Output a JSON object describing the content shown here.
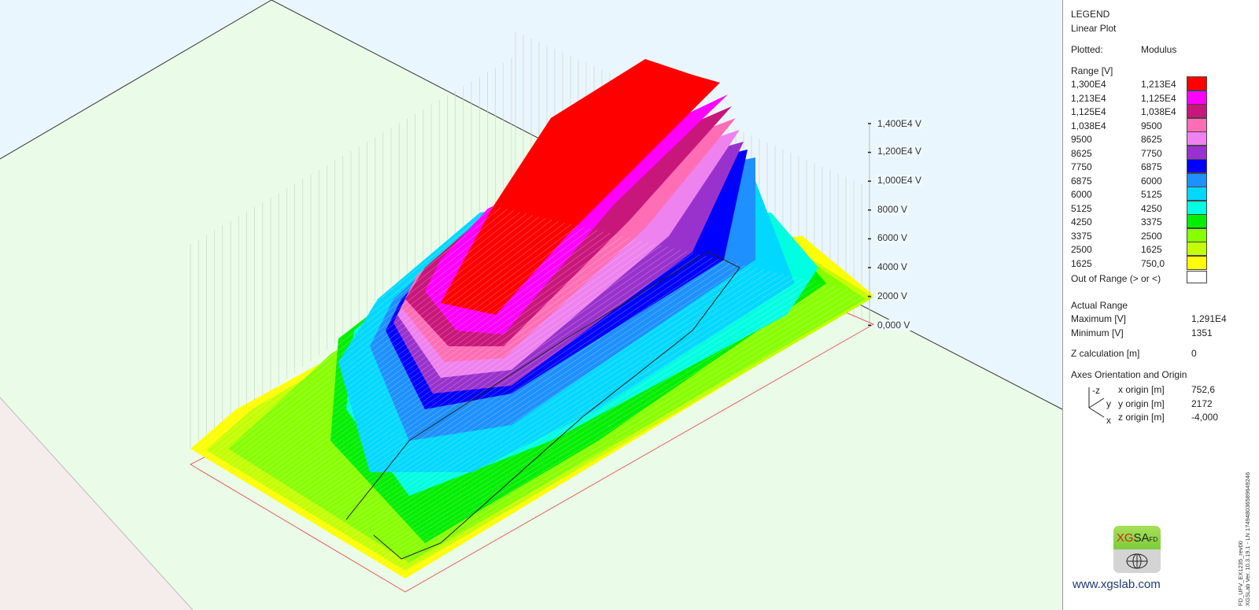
{
  "chart_data": {
    "type": "heatmap",
    "subtype": "3d-surface",
    "z_axis_ticks": [
      "1,400E4 V",
      "1,200E4 V",
      "1,000E4 V",
      "8000 V",
      "6000 V",
      "4000 V",
      "2000 V",
      "0,000 V"
    ],
    "z_range_V": [
      0,
      14000
    ],
    "grid": true
  },
  "legend": {
    "title": "LEGEND",
    "plot_type": "Linear Plot",
    "plotted_label": "Plotted:",
    "plotted_value": "Modulus",
    "range_label": "Range [V]",
    "bins": [
      {
        "from": "1,300E4",
        "to": "1,213E4",
        "color": "#ff0000"
      },
      {
        "from": "1,213E4",
        "to": "1,125E4",
        "color": "#ff00ff"
      },
      {
        "from": "1,125E4",
        "to": "1,038E4",
        "color": "#c8177a"
      },
      {
        "from": "1,038E4",
        "to": "9500",
        "color": "#ff6eb4"
      },
      {
        "from": "9500",
        "to": "8625",
        "color": "#ee82ee"
      },
      {
        "from": "8625",
        "to": "7750",
        "color": "#9932cc"
      },
      {
        "from": "7750",
        "to": "6875",
        "color": "#0000ff"
      },
      {
        "from": "6875",
        "to": "6000",
        "color": "#1e90ff"
      },
      {
        "from": "6000",
        "to": "5125",
        "color": "#00d8ff"
      },
      {
        "from": "5125",
        "to": "4250",
        "color": "#00ffe0"
      },
      {
        "from": "4250",
        "to": "3375",
        "color": "#00ee00"
      },
      {
        "from": "3375",
        "to": "2500",
        "color": "#88ff00"
      },
      {
        "from": "2500",
        "to": "1625",
        "color": "#c4ff00"
      },
      {
        "from": "1625",
        "to": "750,0",
        "color": "#ffff00"
      }
    ],
    "out_of_range_label": "Out of Range (> or <)",
    "out_of_range_color": "#ffffff",
    "actual_range_label": "Actual Range",
    "maximum_label": "Maximum [V]",
    "maximum_value": "1,291E4",
    "minimum_label": "Minimum [V]",
    "minimum_value": "1351",
    "z_calc_label": "Z calculation [m]",
    "z_calc_value": "0",
    "axes_label": "Axes Orientation and Origin",
    "axis_glyphs": {
      "z": "-z",
      "y": "y",
      "x": "x"
    },
    "x_origin_label": "x origin [m]",
    "x_origin_value": "752,6",
    "y_origin_label": "y origin [m]",
    "y_origin_value": "2172",
    "z_origin_label": "z origin [m]",
    "z_origin_value": "-4,000"
  },
  "logo": {
    "xg": "XG",
    "sa": "SA",
    "fd": "FD",
    "url": "www.xgslab.com"
  },
  "footer": {
    "line1": "FD_UFV_EX1235_rev00",
    "line2": "XGSLab Ver. 10.3.19.1  -  LN 174948036589649246"
  }
}
